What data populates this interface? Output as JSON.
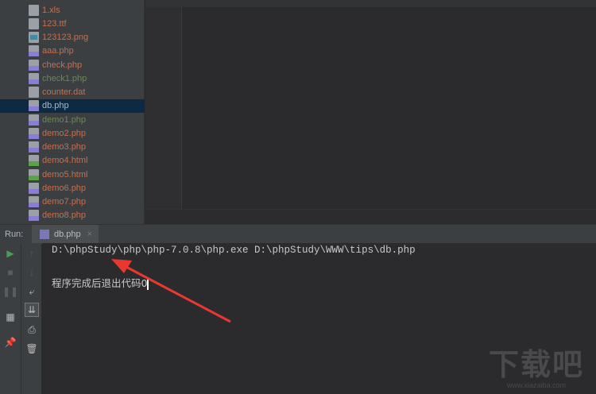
{
  "files": [
    {
      "name": "1.xls",
      "color": "#c96e4a",
      "icon": "xls"
    },
    {
      "name": "123.ttf",
      "color": "#c96e4a",
      "icon": "file"
    },
    {
      "name": "123123.png",
      "color": "#c96e4a",
      "icon": "img"
    },
    {
      "name": "aaa.php",
      "color": "#c96e4a",
      "icon": "php"
    },
    {
      "name": "check.php",
      "color": "#c96e4a",
      "icon": "php"
    },
    {
      "name": "check1.php",
      "color": "#6a8759",
      "icon": "php"
    },
    {
      "name": "counter.dat",
      "color": "#c96e4a",
      "icon": "file"
    },
    {
      "name": "db.php",
      "color": "#a9b7c6",
      "icon": "php",
      "selected": true
    },
    {
      "name": "demo1.php",
      "color": "#6a8759",
      "icon": "php"
    },
    {
      "name": "demo2.php",
      "color": "#c96e4a",
      "icon": "php"
    },
    {
      "name": "demo3.php",
      "color": "#c96e4a",
      "icon": "php"
    },
    {
      "name": "demo4.html",
      "color": "#c96e4a",
      "icon": "html"
    },
    {
      "name": "demo5.html",
      "color": "#c96e4a",
      "icon": "html"
    },
    {
      "name": "demo6.php",
      "color": "#c96e4a",
      "icon": "php"
    },
    {
      "name": "demo7.php",
      "color": "#c96e4a",
      "icon": "php"
    },
    {
      "name": "demo8.php",
      "color": "#c96e4a",
      "icon": "php"
    }
  ],
  "run": {
    "label": "Run:",
    "tab": "db.php",
    "close": "×"
  },
  "console": {
    "command": "D:\\phpStudy\\php\\php-7.0.8\\php.exe D:\\phpStudy\\WWW\\tips\\db.php",
    "output": "程序完成后退出代码0"
  },
  "watermark": {
    "logo": "下载吧",
    "url": "www.xiazaiba.com"
  },
  "annotation_color": "#e8382f"
}
